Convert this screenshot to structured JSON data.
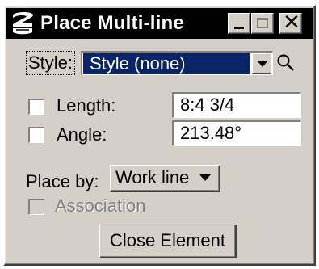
{
  "window": {
    "title": "Place Multi-line",
    "title_buttons": {
      "minimize": "minimize",
      "maximize": "maximize",
      "close": "✕"
    }
  },
  "style": {
    "label": "Style:",
    "selected": "Style (none)"
  },
  "length": {
    "label": "Length:",
    "checked": false,
    "value": "8:4  3/4"
  },
  "angle": {
    "label": "Angle:",
    "checked": false,
    "value": "213.48°"
  },
  "place_by": {
    "label": "Place by:",
    "selected": "Work line"
  },
  "association": {
    "label": "Association",
    "checked": false,
    "enabled": false
  },
  "close_element_button": {
    "label": "Close Element"
  },
  "icons": [
    "app-logo-icon",
    "search-icon",
    "chevron-down-icon"
  ],
  "colors": {
    "titlebar": "#000000",
    "dialog_bg": "#d4d0c8",
    "selection": "#0a246a"
  }
}
